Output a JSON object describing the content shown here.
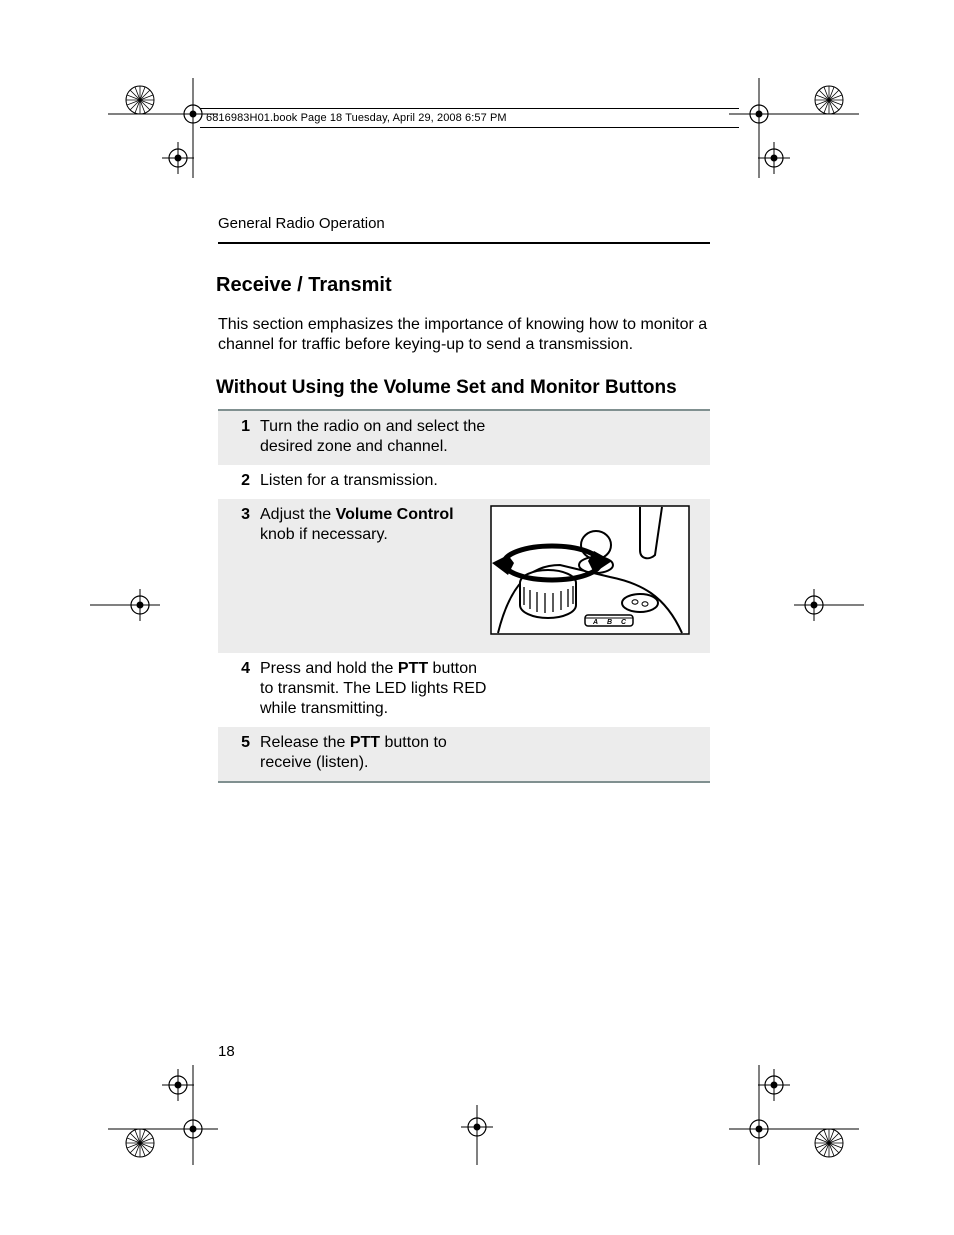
{
  "stamp": "6816983H01.book  Page 18  Tuesday, April 29, 2008  6:57 PM",
  "running_head": "General Radio Operation",
  "title": "Receive / Transmit",
  "intro": "This section emphasizes the importance of knowing how to monitor a channel for traffic before keying-up to send a transmission.",
  "subtitle": "Without Using the Volume Set and Monitor Buttons",
  "steps": {
    "s1": {
      "num": "1",
      "text": "Turn the radio on and select the desired zone and channel."
    },
    "s2": {
      "num": "2",
      "text": "Listen for a transmission."
    },
    "s3": {
      "num": "3",
      "pre": "Adjust the ",
      "bold": "Volume Control",
      "post": " knob if necessary."
    },
    "s4": {
      "num": "4",
      "pre": "Press and hold the ",
      "bold": "PTT",
      "post": " button to transmit. The LED lights RED while transmitting."
    },
    "s5": {
      "num": "5",
      "pre": "Release the ",
      "bold": "PTT",
      "post": " button to receive (listen)."
    }
  },
  "page_number": "18",
  "figure": {
    "labels": {
      "a": "A",
      "b": "B",
      "c": "C"
    }
  }
}
